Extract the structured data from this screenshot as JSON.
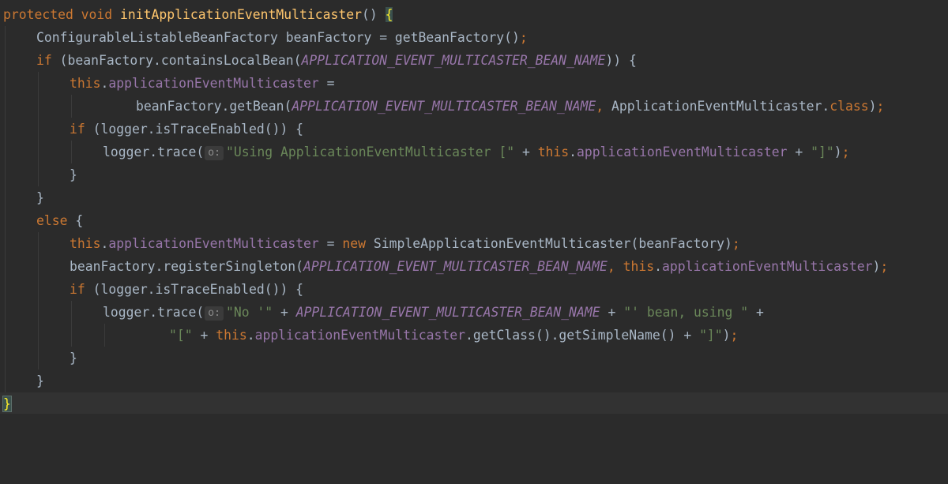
{
  "editor": {
    "colors": {
      "background": "#2b2b2b",
      "current_line": "#323232",
      "keyword": "#cc7832",
      "method_declaration": "#ffc66d",
      "constant": "#9876aa",
      "string": "#6a8759",
      "default_text": "#a9b7c6",
      "brace_match": "#ffef28"
    },
    "lines": [
      {
        "tokens": [
          "protected void ",
          "initApplicationEventMulticaster",
          "() ",
          "{"
        ]
      },
      {
        "tokens": [
          "ConfigurableListableBeanFactory beanFactory = getBeanFactory()",
          ";"
        ]
      },
      {
        "tokens": [
          "if ",
          "(beanFactory.containsLocalBean(",
          "APPLICATION_EVENT_MULTICASTER_BEAN_NAME",
          ")) {"
        ]
      },
      {
        "tokens": [
          "this",
          ".",
          "applicationEventMulticaster",
          " ="
        ]
      },
      {
        "tokens": [
          "beanFactory.getBean(",
          "APPLICATION_EVENT_MULTICASTER_BEAN_NAME",
          ", ",
          "ApplicationEventMulticaster.",
          "class",
          ")",
          ";"
        ]
      },
      {
        "tokens": [
          "if ",
          "(logger.isTraceEnabled()) {"
        ]
      },
      {
        "tokens": [
          "logger.trace(",
          "o:",
          "\"Using ApplicationEventMulticaster [\"",
          " + ",
          "this",
          ".",
          "applicationEventMulticaster",
          " + ",
          "\"]\"",
          ")",
          ";"
        ]
      },
      {
        "tokens": [
          "}"
        ]
      },
      {
        "tokens": [
          "}"
        ]
      },
      {
        "tokens": [
          "else ",
          "{"
        ]
      },
      {
        "tokens": [
          "this",
          ".",
          "applicationEventMulticaster",
          " = ",
          "new ",
          "SimpleApplicationEventMulticaster(beanFactory)",
          ";"
        ]
      },
      {
        "tokens": [
          "beanFactory.registerSingleton(",
          "APPLICATION_EVENT_MULTICASTER_BEAN_NAME",
          ", ",
          "this",
          ".",
          "applicationEventMulticaster",
          ")",
          ";"
        ]
      },
      {
        "tokens": [
          "if ",
          "(logger.isTraceEnabled()) {"
        ]
      },
      {
        "tokens": [
          "logger.trace(",
          "o:",
          "\"No '\"",
          " + ",
          "APPLICATION_EVENT_MULTICASTER_BEAN_NAME",
          " + ",
          "\"' bean, using \"",
          " +"
        ]
      },
      {
        "tokens": [
          "\"[\"",
          " + ",
          "this",
          ".",
          "applicationEventMulticaster",
          ".getClass().getSimpleName() + ",
          "\"]\"",
          ")",
          ";"
        ]
      },
      {
        "tokens": [
          "}"
        ]
      },
      {
        "tokens": [
          "}"
        ]
      },
      {
        "tokens": [
          "}"
        ]
      }
    ]
  }
}
